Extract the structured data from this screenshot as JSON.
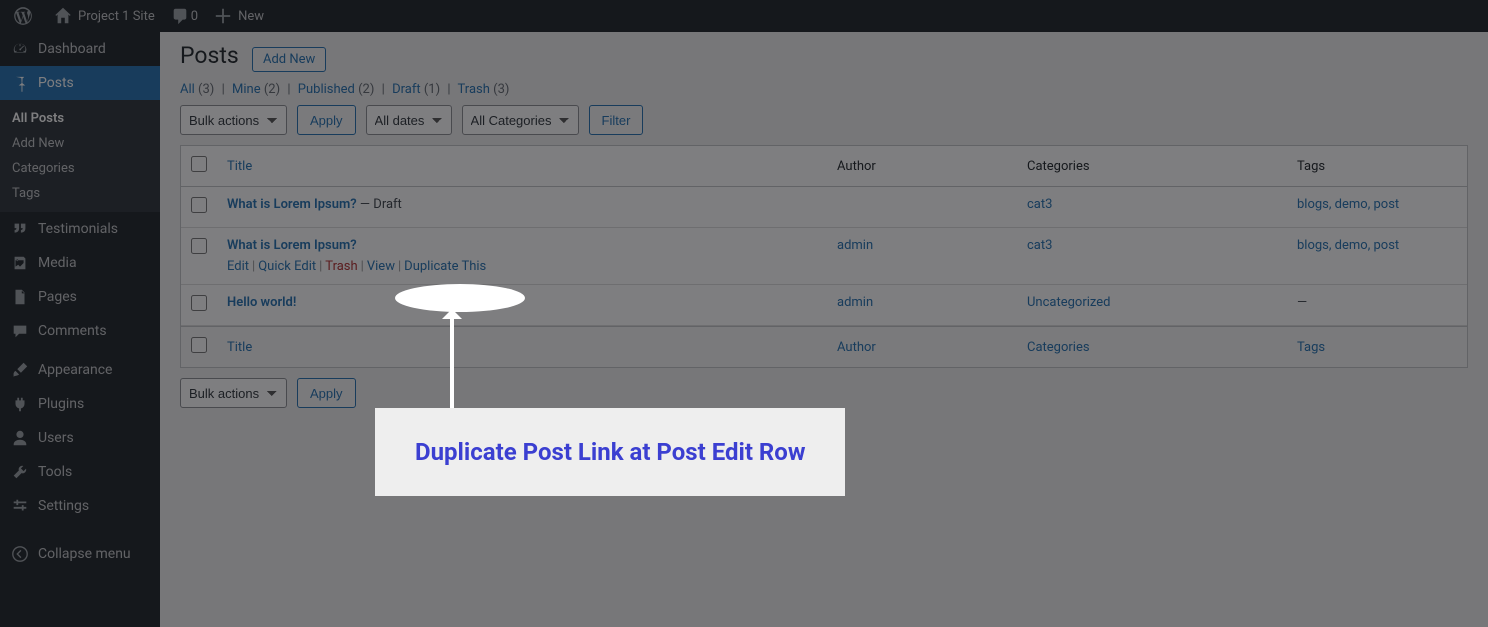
{
  "adminbar": {
    "site_name": "Project 1 Site",
    "comments_count": "0",
    "new_label": "New"
  },
  "menu": {
    "dashboard": "Dashboard",
    "posts": "Posts",
    "posts_sub": {
      "all": "All Posts",
      "add": "Add New",
      "cats": "Categories",
      "tags": "Tags"
    },
    "testimonials": "Testimonials",
    "media": "Media",
    "pages": "Pages",
    "comments": "Comments",
    "appearance": "Appearance",
    "plugins": "Plugins",
    "users": "Users",
    "tools": "Tools",
    "settings": "Settings",
    "collapse": "Collapse menu"
  },
  "page": {
    "heading": "Posts",
    "add_new": "Add New"
  },
  "filters_views": {
    "all": {
      "label": "All",
      "count": "(3)"
    },
    "mine": {
      "label": "Mine",
      "count": "(2)"
    },
    "published": {
      "label": "Published",
      "count": "(2)"
    },
    "draft": {
      "label": "Draft",
      "count": "(1)"
    },
    "trash": {
      "label": "Trash",
      "count": "(3)"
    }
  },
  "tablenav": {
    "bulk": "Bulk actions",
    "apply": "Apply",
    "all_dates": "All dates",
    "all_cats": "All Categories",
    "filter": "Filter"
  },
  "columns": {
    "title": "Title",
    "author": "Author",
    "categories": "Categories",
    "tags": "Tags"
  },
  "row_actions": {
    "edit": "Edit",
    "quick": "Quick Edit",
    "trash": "Trash",
    "view": "View",
    "dup": "Duplicate This"
  },
  "rows": [
    {
      "title": "What is Lorem Ipsum?",
      "state": " — Draft",
      "author": "",
      "categories": "cat3",
      "tags": "blogs, demo, post",
      "show_actions": false
    },
    {
      "title": "What is Lorem Ipsum?",
      "state": "",
      "author": "admin",
      "categories": "cat3",
      "tags": "blogs, demo, post",
      "show_actions": true
    },
    {
      "title": "Hello world!",
      "state": "",
      "author": "admin",
      "categories": "Uncategorized",
      "tags": "—",
      "show_actions": false
    }
  ],
  "annotation": {
    "label": "Duplicate Post Link at Post Edit Row"
  }
}
